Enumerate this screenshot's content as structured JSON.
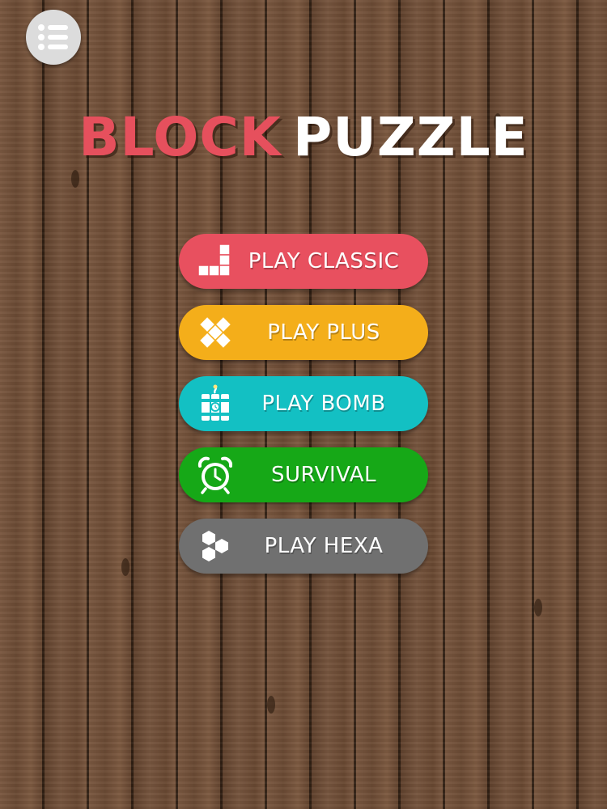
{
  "title": {
    "word1": "BLOCK",
    "word2": "PUZZLE",
    "word1_color": "#e6505d",
    "word2_color": "#ffffff"
  },
  "menu_button": {
    "icon": "list-menu-icon"
  },
  "buttons": [
    {
      "label": "PLAY CLASSIC",
      "color": "#e8505f",
      "icon": "tetromino-blocks-icon"
    },
    {
      "label": "PLAY PLUS",
      "color": "#f4ae1a",
      "icon": "plus-blocks-icon"
    },
    {
      "label": "PLAY BOMB",
      "color": "#13c0c3",
      "icon": "dynamite-bomb-icon"
    },
    {
      "label": "SURVIVAL",
      "color": "#16a817",
      "icon": "alarm-clock-icon"
    },
    {
      "label": "PLAY HEXA",
      "color": "#707070",
      "icon": "hexagons-icon"
    }
  ]
}
